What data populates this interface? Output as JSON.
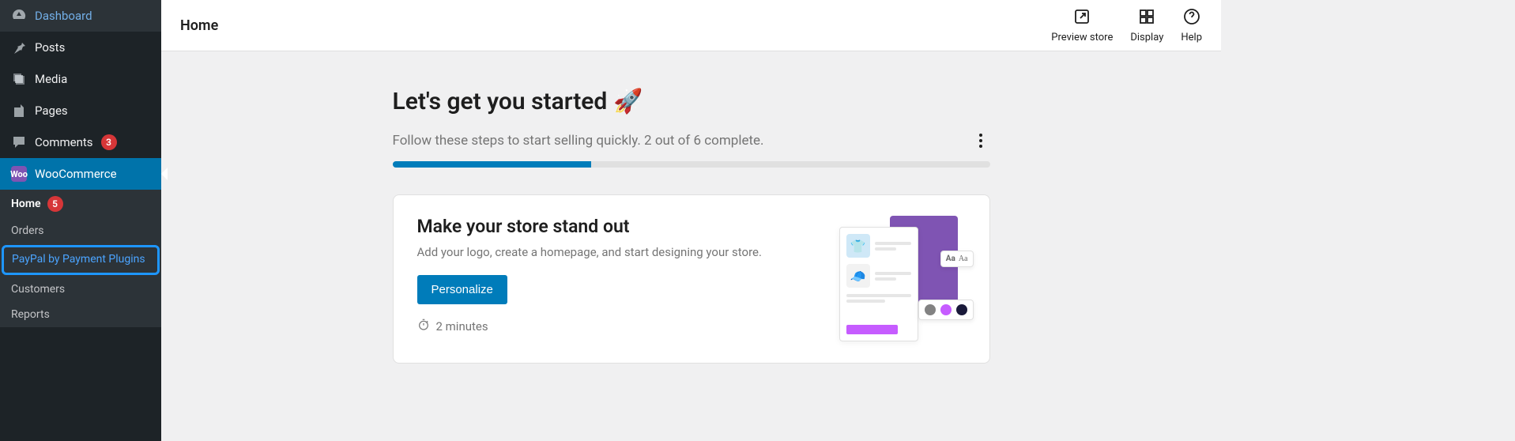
{
  "sidebar": {
    "items": [
      {
        "label": "Dashboard"
      },
      {
        "label": "Posts"
      },
      {
        "label": "Media"
      },
      {
        "label": "Pages"
      },
      {
        "label": "Comments",
        "badge": "3"
      },
      {
        "label": "WooCommerce"
      }
    ],
    "sub": [
      {
        "label": "Home",
        "badge": "5"
      },
      {
        "label": "Orders"
      },
      {
        "label": "PayPal by Payment Plugins"
      },
      {
        "label": "Customers"
      },
      {
        "label": "Reports"
      }
    ]
  },
  "topbar": {
    "title": "Home",
    "actions": {
      "preview": "Preview store",
      "display": "Display",
      "help": "Help"
    }
  },
  "page": {
    "heading": "Let's get you started",
    "emoji": "🚀",
    "progress_text": "Follow these steps to start selling quickly. 2 out of 6 complete.",
    "progress_completed": 2,
    "progress_total": 6
  },
  "card": {
    "title": "Make your store stand out",
    "desc": "Add your logo, create a homepage, and start designing your store.",
    "button": "Personalize",
    "time_icon": "stopwatch-icon",
    "time": "2 minutes"
  },
  "illustration": {
    "font_sample": "Aa",
    "dot_colors": [
      "#828282",
      "#c65cff",
      "#1a1a3a"
    ]
  }
}
